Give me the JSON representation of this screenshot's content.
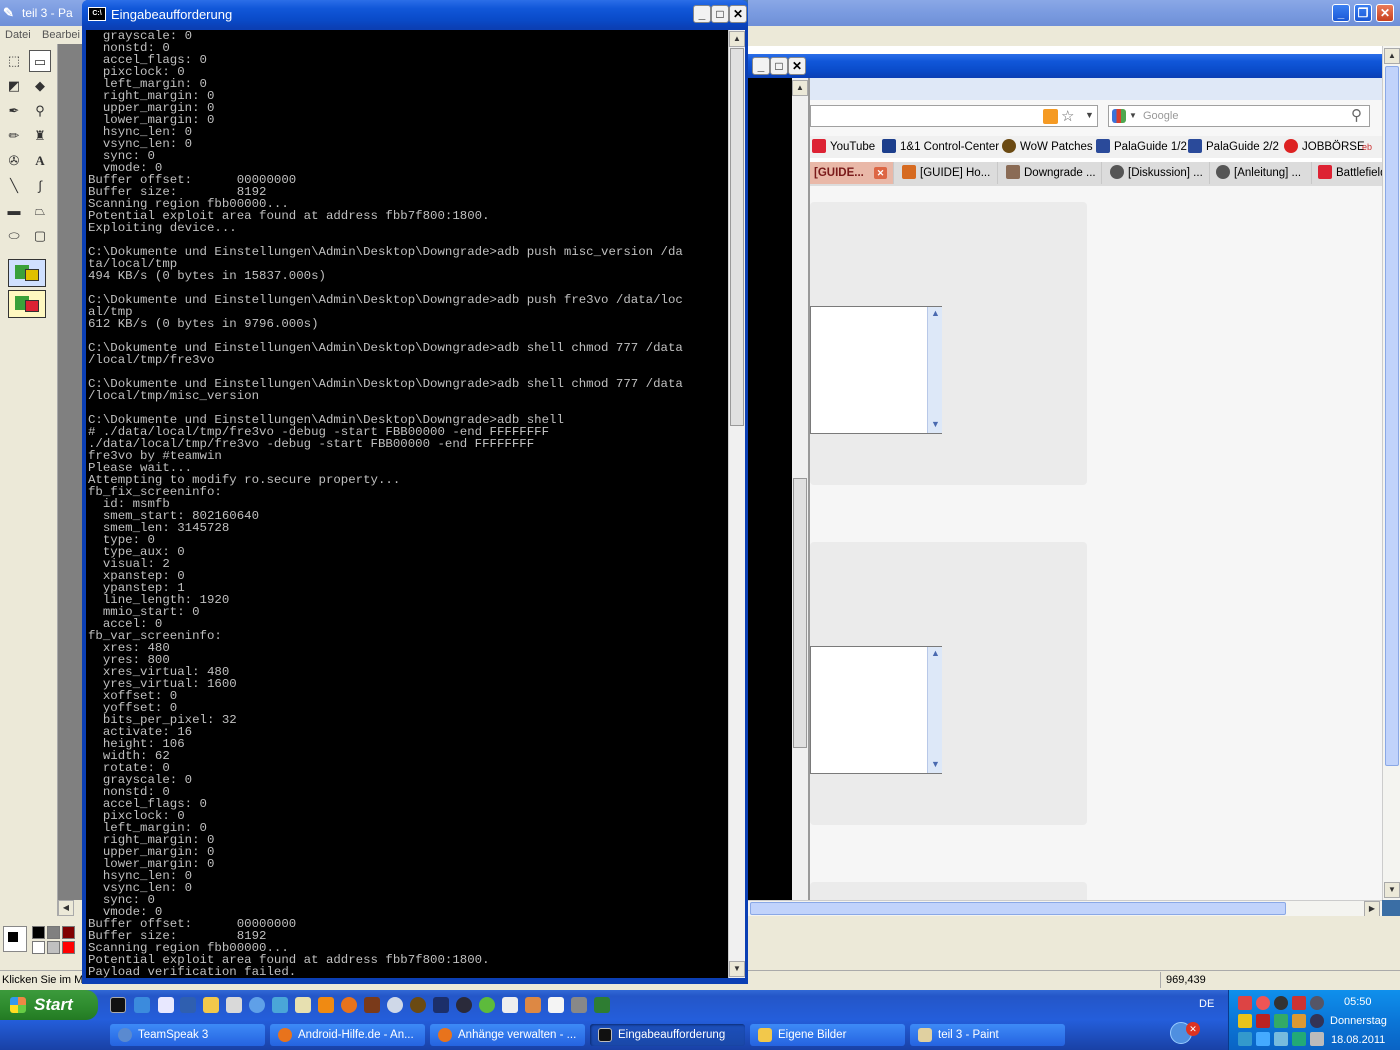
{
  "paint": {
    "title": "teil 3 - Pa",
    "menu": [
      "Datei",
      "Bearbei"
    ],
    "status_text": "Klicken Sie im Me",
    "coords": "969,439"
  },
  "console": {
    "title": "Eingabeaufforderung",
    "lines": [
      "  grayscale: 0",
      "  nonstd: 0",
      "  accel_flags: 0",
      "  pixclock: 0",
      "  left_margin: 0",
      "  right_margin: 0",
      "  upper_margin: 0",
      "  lower_margin: 0",
      "  hsync_len: 0",
      "  vsync_len: 0",
      "  sync: 0",
      "  vmode: 0",
      "Buffer offset:      00000000",
      "Buffer size:        8192",
      "Scanning region fbb00000...",
      "Potential exploit area found at address fbb7f800:1800.",
      "Exploiting device...",
      "",
      "C:\\Dokumente und Einstellungen\\Admin\\Desktop\\Downgrade>adb push misc_version /da",
      "ta/local/tmp",
      "494 KB/s (0 bytes in 15837.000s)",
      "",
      "C:\\Dokumente und Einstellungen\\Admin\\Desktop\\Downgrade>adb push fre3vo /data/loc",
      "al/tmp",
      "612 KB/s (0 bytes in 9796.000s)",
      "",
      "C:\\Dokumente und Einstellungen\\Admin\\Desktop\\Downgrade>adb shell chmod 777 /data",
      "/local/tmp/fre3vo",
      "",
      "C:\\Dokumente und Einstellungen\\Admin\\Desktop\\Downgrade>adb shell chmod 777 /data",
      "/local/tmp/misc_version",
      "",
      "C:\\Dokumente und Einstellungen\\Admin\\Desktop\\Downgrade>adb shell",
      "# ./data/local/tmp/fre3vo -debug -start FBB00000 -end FFFFFFFF",
      "./data/local/tmp/fre3vo -debug -start FBB00000 -end FFFFFFFF",
      "fre3vo by #teamwin",
      "Please wait...",
      "Attempting to modify ro.secure property...",
      "fb_fix_screeninfo:",
      "  id: msmfb",
      "  smem_start: 802160640",
      "  smem_len: 3145728",
      "  type: 0",
      "  type_aux: 0",
      "  visual: 2",
      "  xpanstep: 0",
      "  ypanstep: 1",
      "  line_length: 1920",
      "  mmio_start: 0",
      "  accel: 0",
      "fb_var_screeninfo:",
      "  xres: 480",
      "  yres: 800",
      "  xres_virtual: 480",
      "  yres_virtual: 1600",
      "  xoffset: 0",
      "  yoffset: 0",
      "  bits_per_pixel: 32",
      "  activate: 16",
      "  height: 106",
      "  width: 62",
      "  rotate: 0",
      "  grayscale: 0",
      "  nonstd: 0",
      "  accel_flags: 0",
      "  pixclock: 0",
      "  left_margin: 0",
      "  right_margin: 0",
      "  upper_margin: 0",
      "  lower_margin: 0",
      "  hsync_len: 0",
      "  vsync_len: 0",
      "  sync: 0",
      "  vmode: 0",
      "Buffer offset:      00000000",
      "Buffer size:        8192",
      "Scanning region fbb00000...",
      "Potential exploit area found at address fbb7f800:1800.",
      "Payload verification failed."
    ]
  },
  "browser": {
    "search_placeholder": "Google",
    "bookmarks": [
      "YouTube",
      "1&1 Control-Center",
      "WoW Patches",
      "PalaGuide 1/2",
      "PalaGuide 2/2",
      "JOBBÖRSE"
    ],
    "tabs": [
      "[GUIDE...",
      "[GUIDE] Ho...",
      "Downgrade ...",
      "[Diskussion] ...",
      "[Anleitung] ...",
      "Battlefield"
    ]
  },
  "taskbar": {
    "start_label": "Start",
    "items": [
      "TeamSpeak 3",
      "Android-Hilfe.de - An...",
      "Anhänge verwalten - ...",
      "Eingabeaufforderung",
      "Eigene Bilder",
      "teil 3 - Paint"
    ],
    "language": "DE",
    "clock_time": "05:50",
    "clock_day": "Donnerstag",
    "clock_date": "18.08.2011"
  }
}
